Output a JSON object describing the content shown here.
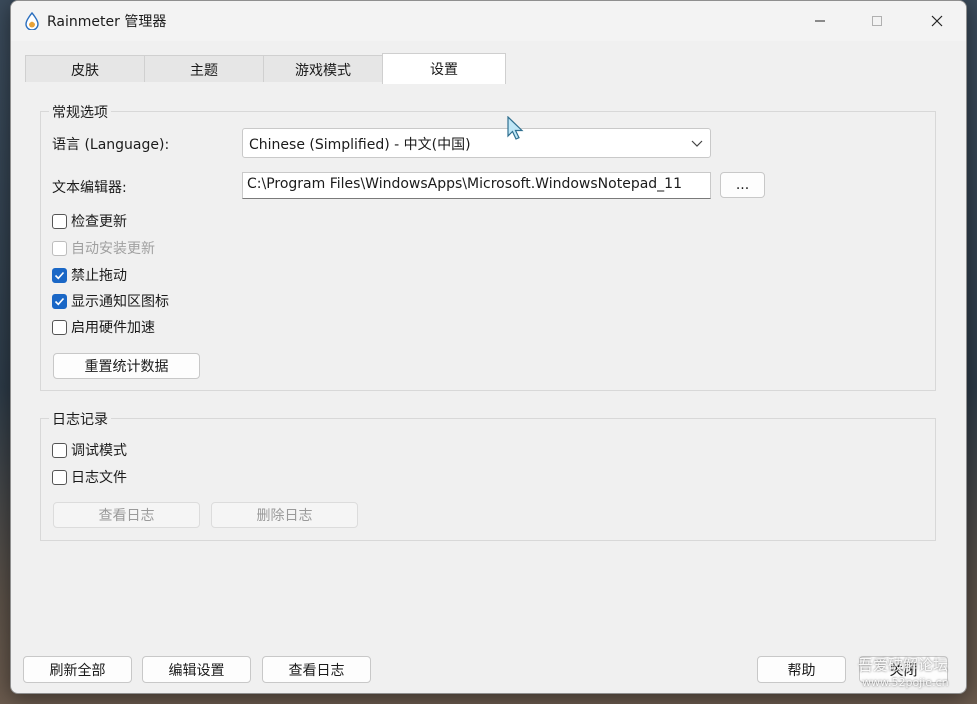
{
  "window": {
    "title": "Rainmeter 管理器",
    "icon": "rainmeter-drop-icon"
  },
  "tabs": [
    {
      "label": "皮肤",
      "active": false
    },
    {
      "label": "主题",
      "active": false
    },
    {
      "label": "游戏模式",
      "active": false
    },
    {
      "label": "设置",
      "active": true
    }
  ],
  "general": {
    "legend": "常规选项",
    "language_label": "语言 (Language):",
    "language_value": "Chinese (Simplified) - 中文(中国)",
    "editor_label": "文本编辑器:",
    "editor_value": "C:\\Program Files\\WindowsApps\\Microsoft.WindowsNotepad_11",
    "browse_label": "...",
    "checks": [
      {
        "label": "检查更新",
        "checked": false,
        "disabled": false
      },
      {
        "label": "自动安装更新",
        "checked": false,
        "disabled": true
      },
      {
        "label": "禁止拖动",
        "checked": true,
        "disabled": false
      },
      {
        "label": "显示通知区图标",
        "checked": true,
        "disabled": false
      },
      {
        "label": "启用硬件加速",
        "checked": false,
        "disabled": false
      }
    ],
    "reset_label": "重置统计数据"
  },
  "logging": {
    "legend": "日志记录",
    "checks": [
      {
        "label": "调试模式",
        "checked": false
      },
      {
        "label": "日志文件",
        "checked": false
      }
    ],
    "view_log_label": "查看日志",
    "delete_log_label": "删除日志"
  },
  "footer": {
    "refresh_all": "刷新全部",
    "edit_settings": "编辑设置",
    "view_log": "查看日志",
    "help": "帮助",
    "close": "关闭"
  },
  "watermark": {
    "line1": "吾爱破解论坛",
    "line2": "www.52pojie.cn"
  },
  "colors": {
    "accent": "#1a67c6",
    "window_bg": "#f0f0f0"
  }
}
